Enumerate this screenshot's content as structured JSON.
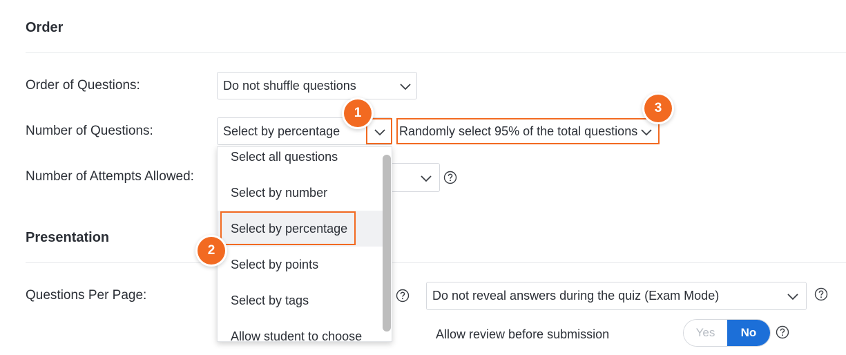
{
  "order": {
    "heading": "Order",
    "order_of_questions": {
      "label": "Order of Questions:",
      "value": "Do not shuffle questions"
    },
    "number_of_questions": {
      "label": "Number of Questions:",
      "value": "Select by percentage",
      "secondary_value": "Randomly select 95% of the total questions"
    },
    "attempts": {
      "label": "Number of Attempts Allowed:"
    }
  },
  "dropdown": {
    "options": [
      "Select all questions",
      "Select by number",
      "Select by percentage",
      "Select by points",
      "Select by tags",
      "Allow student to choose"
    ],
    "selected": "Select by percentage"
  },
  "presentation": {
    "heading": "Presentation",
    "questions_per_page": {
      "label": "Questions Per Page:"
    },
    "reveal_answers": {
      "value": "Do not reveal answers during the quiz (Exam Mode)"
    },
    "review": {
      "label": "Allow review before submission",
      "yes": "Yes",
      "no": "No",
      "selected": "No"
    }
  },
  "callouts": [
    "1",
    "2",
    "3"
  ],
  "colors": {
    "accent": "#f26a21",
    "primary": "#1c6fd8",
    "text": "#2b2f36",
    "border": "#d6d9de"
  },
  "icons": {
    "dropdown": "chevron-down-icon",
    "help": "question-circle-icon"
  }
}
